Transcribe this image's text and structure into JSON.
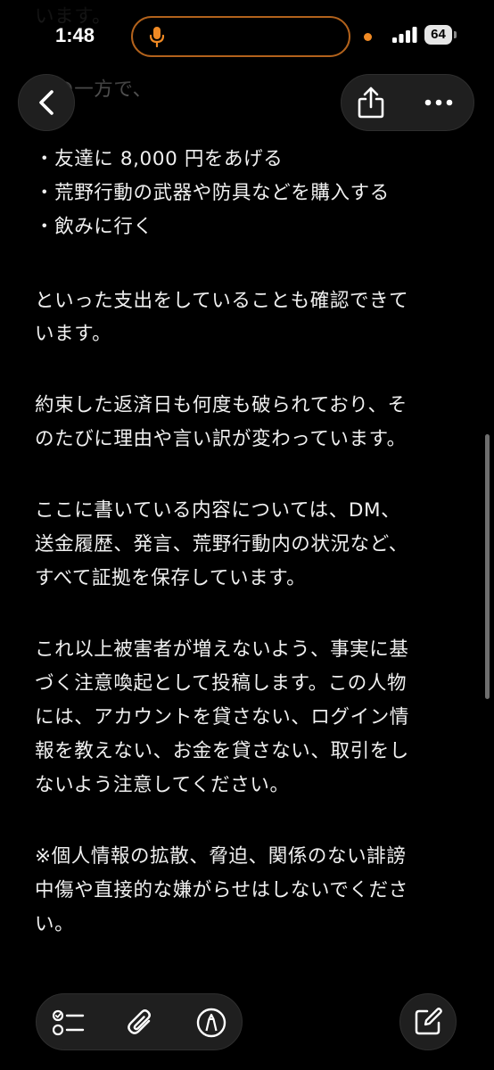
{
  "status_bar": {
    "time": "1:48",
    "battery": "64"
  },
  "note": {
    "lines": [
      "います。",
      "その一方で、",
      "・友達に 8,000 円をあげる",
      "・荒野行動の武器や防具などを購入する",
      "・飲みに行く",
      "といった支出をしていることも確認できて",
      "います。",
      "約束した返済日も何度も破られており、そ",
      "のたびに理由や言い訳が変わっています。",
      "ここに書いている内容については、DM、",
      "送金履歴、発言、荒野行動内の状況など、",
      "すべて証拠を保存しています。",
      "これ以上被害者が増えないよう、事実に基",
      "づく注意喚起として投稿します。この人物",
      "には、アカウントを貸さない、ログイン情",
      "報を教えない、お金を貸さない、取引をし",
      "ないよう注意してください。",
      "※個人情報の拡散、脅迫、関係のない誹謗",
      "中傷や直接的な嫌がらせはしないでくださ",
      "い。"
    ]
  },
  "icons": {
    "back": "chevron-left-icon",
    "share": "share-icon",
    "more": "ellipsis-icon",
    "checklist": "checklist-icon",
    "attach": "paperclip-icon",
    "markup": "markup-pen-icon",
    "compose": "compose-icon",
    "mic": "microphone-icon"
  },
  "colors": {
    "background": "#000000",
    "text": "#f0f0f0",
    "accent_orange": "#f08a24",
    "button_bg": "#1f1f1f"
  }
}
